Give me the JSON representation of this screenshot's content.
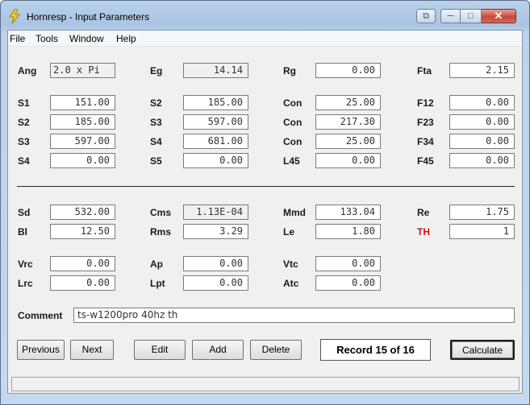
{
  "window": {
    "title": "Hornresp - Input Parameters",
    "controls": {
      "menu": "⧉",
      "minimize": "─",
      "maximize": "□",
      "close": "✕"
    }
  },
  "menubar": {
    "file": "File",
    "tools": "Tools",
    "window": "Window",
    "help": "Help"
  },
  "params": {
    "ang": {
      "label": "Ang",
      "value": "2.0 x Pi"
    },
    "eg": {
      "label": "Eg",
      "value": "14.14"
    },
    "rg": {
      "label": "Rg",
      "value": "0.00"
    },
    "fta": {
      "label": "Fta",
      "value": "2.15"
    },
    "s1": {
      "label": "S1",
      "value": "151.00"
    },
    "s2b": {
      "label": "S2",
      "value": "185.00"
    },
    "con1": {
      "label": "Con",
      "value": "25.00"
    },
    "f12": {
      "label": "F12",
      "value": "0.00"
    },
    "s2": {
      "label": "S2",
      "value": "185.00"
    },
    "s3b": {
      "label": "S3",
      "value": "597.00"
    },
    "con2": {
      "label": "Con",
      "value": "217.30"
    },
    "f23": {
      "label": "F23",
      "value": "0.00"
    },
    "s3": {
      "label": "S3",
      "value": "597.00"
    },
    "s4b": {
      "label": "S4",
      "value": "681.00"
    },
    "con3": {
      "label": "Con",
      "value": "25.00"
    },
    "f34": {
      "label": "F34",
      "value": "0.00"
    },
    "s4": {
      "label": "S4",
      "value": "0.00"
    },
    "s5": {
      "label": "S5",
      "value": "0.00"
    },
    "l45": {
      "label": "L45",
      "value": "0.00"
    },
    "f45": {
      "label": "F45",
      "value": "0.00"
    },
    "sd": {
      "label": "Sd",
      "value": "532.00"
    },
    "cms": {
      "label": "Cms",
      "value": "1.13E-04"
    },
    "mmd": {
      "label": "Mmd",
      "value": "133.04"
    },
    "re": {
      "label": "Re",
      "value": "1.75"
    },
    "bl": {
      "label": "Bl",
      "value": "12.50"
    },
    "rms": {
      "label": "Rms",
      "value": "3.29"
    },
    "le": {
      "label": "Le",
      "value": "1.80"
    },
    "th": {
      "label": "TH",
      "value": "1"
    },
    "vrc": {
      "label": "Vrc",
      "value": "0.00"
    },
    "ap": {
      "label": "Ap",
      "value": "0.00"
    },
    "vtc": {
      "label": "Vtc",
      "value": "0.00"
    },
    "lrc": {
      "label": "Lrc",
      "value": "0.00"
    },
    "lpt": {
      "label": "Lpt",
      "value": "0.00"
    },
    "atc": {
      "label": "Atc",
      "value": "0.00"
    }
  },
  "comment": {
    "label": "Comment",
    "value": "ts-w1200pro 40hz th"
  },
  "buttons": {
    "previous": "Previous",
    "next": "Next",
    "edit": "Edit",
    "add": "Add",
    "delete": "Delete",
    "calculate": "Calculate"
  },
  "record": "Record 15 of 16",
  "colors": {
    "accent_red": "#c01818",
    "title_gradient": "#b9d1ea",
    "close_red": "#c9473a"
  }
}
